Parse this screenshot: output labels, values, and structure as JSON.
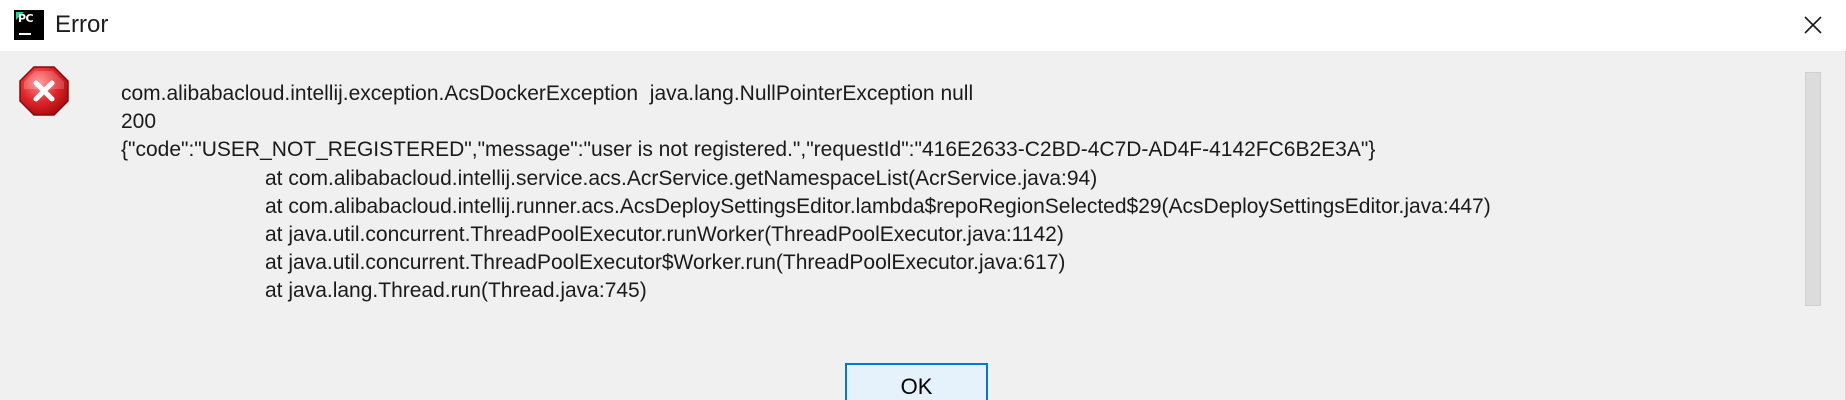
{
  "window": {
    "title": "Error",
    "app_icon": "pycharm-app-icon",
    "app_icon_text": "PC",
    "close_icon": "close-icon"
  },
  "dialog": {
    "status_icon": "error-icon",
    "message_lines": [
      "com.alibabacloud.intellij.exception.AcsDockerException  java.lang.NullPointerException null",
      "200",
      "{\"code\":\"USER_NOT_REGISTERED\",\"message\":\"user is not registered.\",\"requestId\":\"416E2633-C2BD-4C7D-AD4F-4142FC6B2E3A\"}"
    ],
    "stack_trace": [
      "at com.alibabacloud.intellij.service.acs.AcrService.getNamespaceList(AcrService.java:94)",
      "at com.alibabacloud.intellij.runner.acs.AcsDeploySettingsEditor.lambda$repoRegionSelected$29(AcsDeploySettingsEditor.java:447)",
      "at java.util.concurrent.ThreadPoolExecutor.runWorker(ThreadPoolExecutor.java:1142)",
      "at java.util.concurrent.ThreadPoolExecutor$Worker.run(ThreadPoolExecutor.java:617)",
      "at java.lang.Thread.run(Thread.java:745)"
    ],
    "ok_label": "OK"
  },
  "colors": {
    "dialog_bg": "#f0f0f0",
    "titlebar_bg": "#ffffff",
    "error_red": "#e81123",
    "button_focus": "#0078d7",
    "button_bg": "#e5f1fb"
  }
}
